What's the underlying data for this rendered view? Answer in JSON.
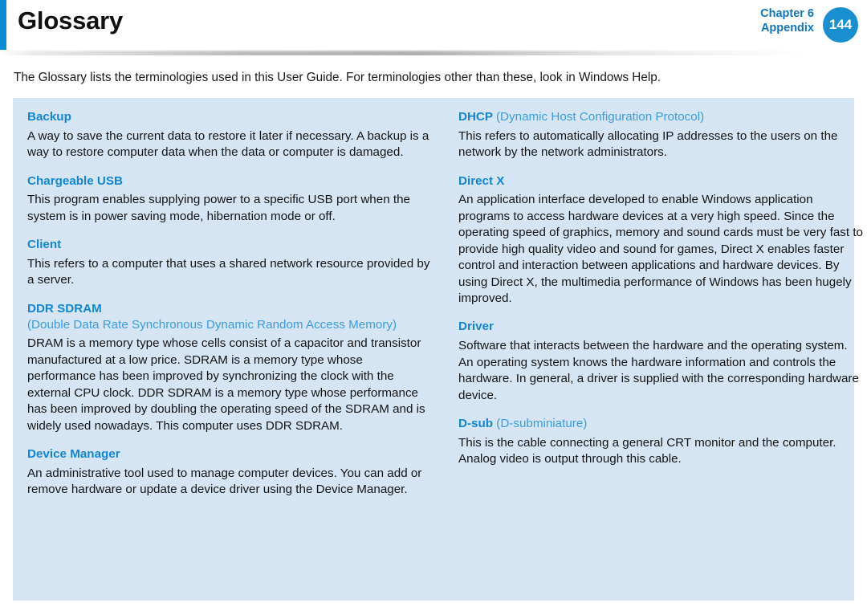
{
  "header": {
    "title": "Glossary",
    "chapter_label": "Chapter 6",
    "section_label": "Appendix",
    "page_number": "144",
    "accent_color": "#0d8ad6",
    "badge_color": "#1a8fd0",
    "chapter_text_color": "#1077bd"
  },
  "intro": {
    "text": "The Glossary lists the terminologies used in this User Guide. For terminologies other than these, look in Windows Help."
  },
  "panel": {
    "background_color": "#d5e5f3",
    "heading_color": "#1385d3",
    "expansion_color": "#3c9bdd",
    "body_color": "#141414"
  },
  "columns": [
    {
      "name": "left-column",
      "entries": [
        {
          "term": "Backup",
          "expansion": "",
          "expansion_style": "none",
          "body": "A way to save the current data to restore it later if necessary. A backup is a way to restore computer data when the data or computer is damaged."
        },
        {
          "term": "Chargeable USB",
          "expansion": "",
          "expansion_style": "none",
          "body": "This program enables supplying power to a specific USB port when the system is in power saving mode, hibernation mode or off."
        },
        {
          "term": "Client",
          "expansion": "",
          "expansion_style": "none",
          "body": "This refers to a computer that uses a shared network resource provided by a server."
        },
        {
          "term": "DDR SDRAM",
          "expansion": "(Double Data Rate Synchronous Dynamic Random Access Memory)",
          "expansion_style": "block",
          "body": "DRAM is a memory type whose cells consist of a capacitor and transistor manufactured at a low price. SDRAM is a memory type whose performance has been improved by synchronizing the clock with the external CPU clock. DDR SDRAM is a memory type whose performance has been improved by doubling the operating speed of the SDRAM and is widely used nowadays. This computer uses DDR SDRAM."
        },
        {
          "term": "Device Manager",
          "expansion": "",
          "expansion_style": "none",
          "body": "An administrative tool used to manage computer devices. You can add or remove hardware or update a device driver using the Device Manager."
        }
      ]
    },
    {
      "name": "right-column",
      "entries": [
        {
          "term": "DHCP",
          "expansion": "(Dynamic Host Configuration Protocol)",
          "expansion_style": "inline",
          "body": "This refers to automatically allocating IP addresses to the users on the network by the network administrators."
        },
        {
          "term": "Direct X",
          "expansion": "",
          "expansion_style": "none",
          "body": "An application interface developed to enable Windows application programs to access hardware devices at a very high speed. Since the operating speed of graphics, memory and sound cards must be very fast to provide high quality video and sound for games, Direct X enables faster control and interaction between applications and hardware devices. By using Direct X, the multimedia performance of Windows has been hugely improved."
        },
        {
          "term": "Driver",
          "expansion": "",
          "expansion_style": "none",
          "body": "Software that interacts between the hardware and the operating system. An operating system knows the hardware information and controls the hardware. In general, a driver is supplied with the corresponding hardware device."
        },
        {
          "term": "D-sub",
          "expansion": "(D-subminiature)",
          "expansion_style": "inline",
          "body": "This is the cable connecting a general CRT monitor and the computer. Analog video is output through this cable."
        }
      ]
    }
  ]
}
